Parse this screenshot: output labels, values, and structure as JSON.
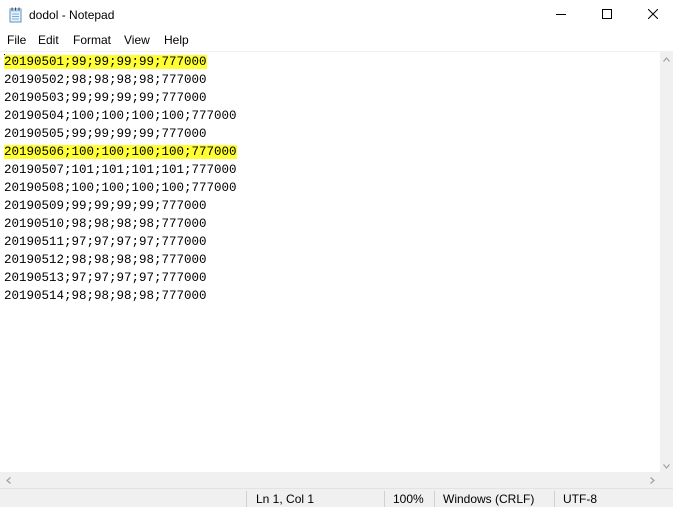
{
  "window": {
    "title": "dodol - Notepad"
  },
  "menu": {
    "items": [
      "File",
      "Edit",
      "Format",
      "View",
      "Help"
    ]
  },
  "editor": {
    "highlight_color": "#ffff33",
    "lines": [
      {
        "text": "20190501;99;99;99;99;777000",
        "highlighted": true
      },
      {
        "text": "20190502;98;98;98;98;777000",
        "highlighted": false
      },
      {
        "text": "20190503;99;99;99;99;777000",
        "highlighted": false
      },
      {
        "text": "20190504;100;100;100;100;777000",
        "highlighted": false
      },
      {
        "text": "20190505;99;99;99;99;777000",
        "highlighted": false
      },
      {
        "text": "20190506;100;100;100;100;777000",
        "highlighted": true
      },
      {
        "text": "20190507;101;101;101;101;777000",
        "highlighted": false
      },
      {
        "text": "20190508;100;100;100;100;777000",
        "highlighted": false
      },
      {
        "text": "20190509;99;99;99;99;777000",
        "highlighted": false
      },
      {
        "text": "20190510;98;98;98;98;777000",
        "highlighted": false
      },
      {
        "text": "20190511;97;97;97;97;777000",
        "highlighted": false
      },
      {
        "text": "20190512;98;98;98;98;777000",
        "highlighted": false
      },
      {
        "text": "20190513;97;97;97;97;777000",
        "highlighted": false
      },
      {
        "text": "20190514;98;98;98;98;777000",
        "highlighted": false
      }
    ]
  },
  "statusbar": {
    "position": "Ln 1, Col 1",
    "zoom": "100%",
    "line_ending": "Windows (CRLF)",
    "encoding": "UTF-8"
  },
  "icons": {
    "app": "notepad-icon",
    "minimize": "minimize-icon",
    "maximize": "maximize-icon",
    "close": "close-icon"
  }
}
